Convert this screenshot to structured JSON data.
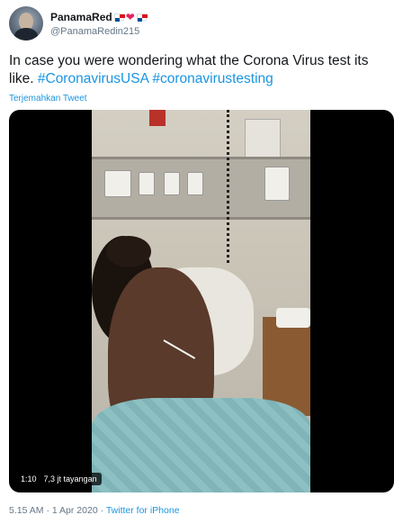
{
  "author": {
    "display_name": "PanamaRed",
    "handle": "@PanamaRedin215",
    "name_emojis": [
      "panama-flag",
      "red-heart",
      "panama-flag"
    ]
  },
  "tweet": {
    "text_plain": "In case you were wondering what the Corona Virus test its like. ",
    "hashtag1": "#CoronavirusUSA",
    "hashtag2": "#coronavirustesting",
    "translate_label": "Terjemahkan Tweet"
  },
  "video": {
    "duration": "1:10",
    "views": "7,3 jt tayangan"
  },
  "meta": {
    "time": "5.15 AM",
    "sep1": "·",
    "date": "1 Apr 2020",
    "sep2": "·",
    "source": "Twitter for iPhone"
  },
  "colors": {
    "link": "#1b95e0",
    "muted": "#657786",
    "text": "#14171a"
  }
}
